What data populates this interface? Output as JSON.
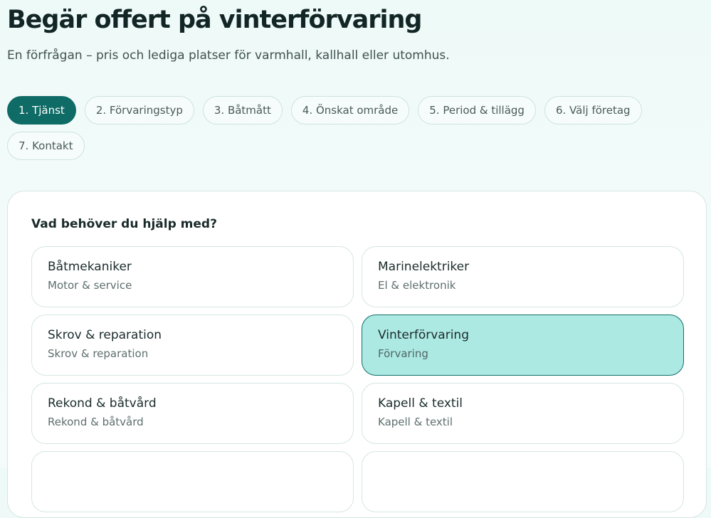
{
  "header": {
    "title": "Begär offert på vinterförvaring",
    "subtitle": "En förfrågan – pris och lediga platser för varmhall, kallhall eller utomhus."
  },
  "steps": [
    {
      "label": "1. Tjänst",
      "active": true
    },
    {
      "label": "2. Förvaringstyp",
      "active": false
    },
    {
      "label": "3. Båtmått",
      "active": false
    },
    {
      "label": "4. Önskat område",
      "active": false
    },
    {
      "label": "5. Period & tillägg",
      "active": false
    },
    {
      "label": "6. Välj företag",
      "active": false
    },
    {
      "label": "7. Kontakt",
      "active": false
    }
  ],
  "service": {
    "question": "Vad behöver du hjälp med?",
    "selected": "Vinterförvaring",
    "options": [
      {
        "title": "Båtmekaniker",
        "subtitle": "Motor & service"
      },
      {
        "title": "Marinelektriker",
        "subtitle": "El & elektronik"
      },
      {
        "title": "Skrov & reparation",
        "subtitle": "Skrov & reparation"
      },
      {
        "title": "Vinterförvaring",
        "subtitle": "Förvaring"
      },
      {
        "title": "Rekond & båtvård",
        "subtitle": "Rekond & båtvård"
      },
      {
        "title": "Kapell & textil",
        "subtitle": "Kapell & textil"
      }
    ]
  },
  "colors": {
    "accent": "#0f6b66",
    "selected_bg": "#ade9e3",
    "page_bg": "#eefaf8"
  }
}
